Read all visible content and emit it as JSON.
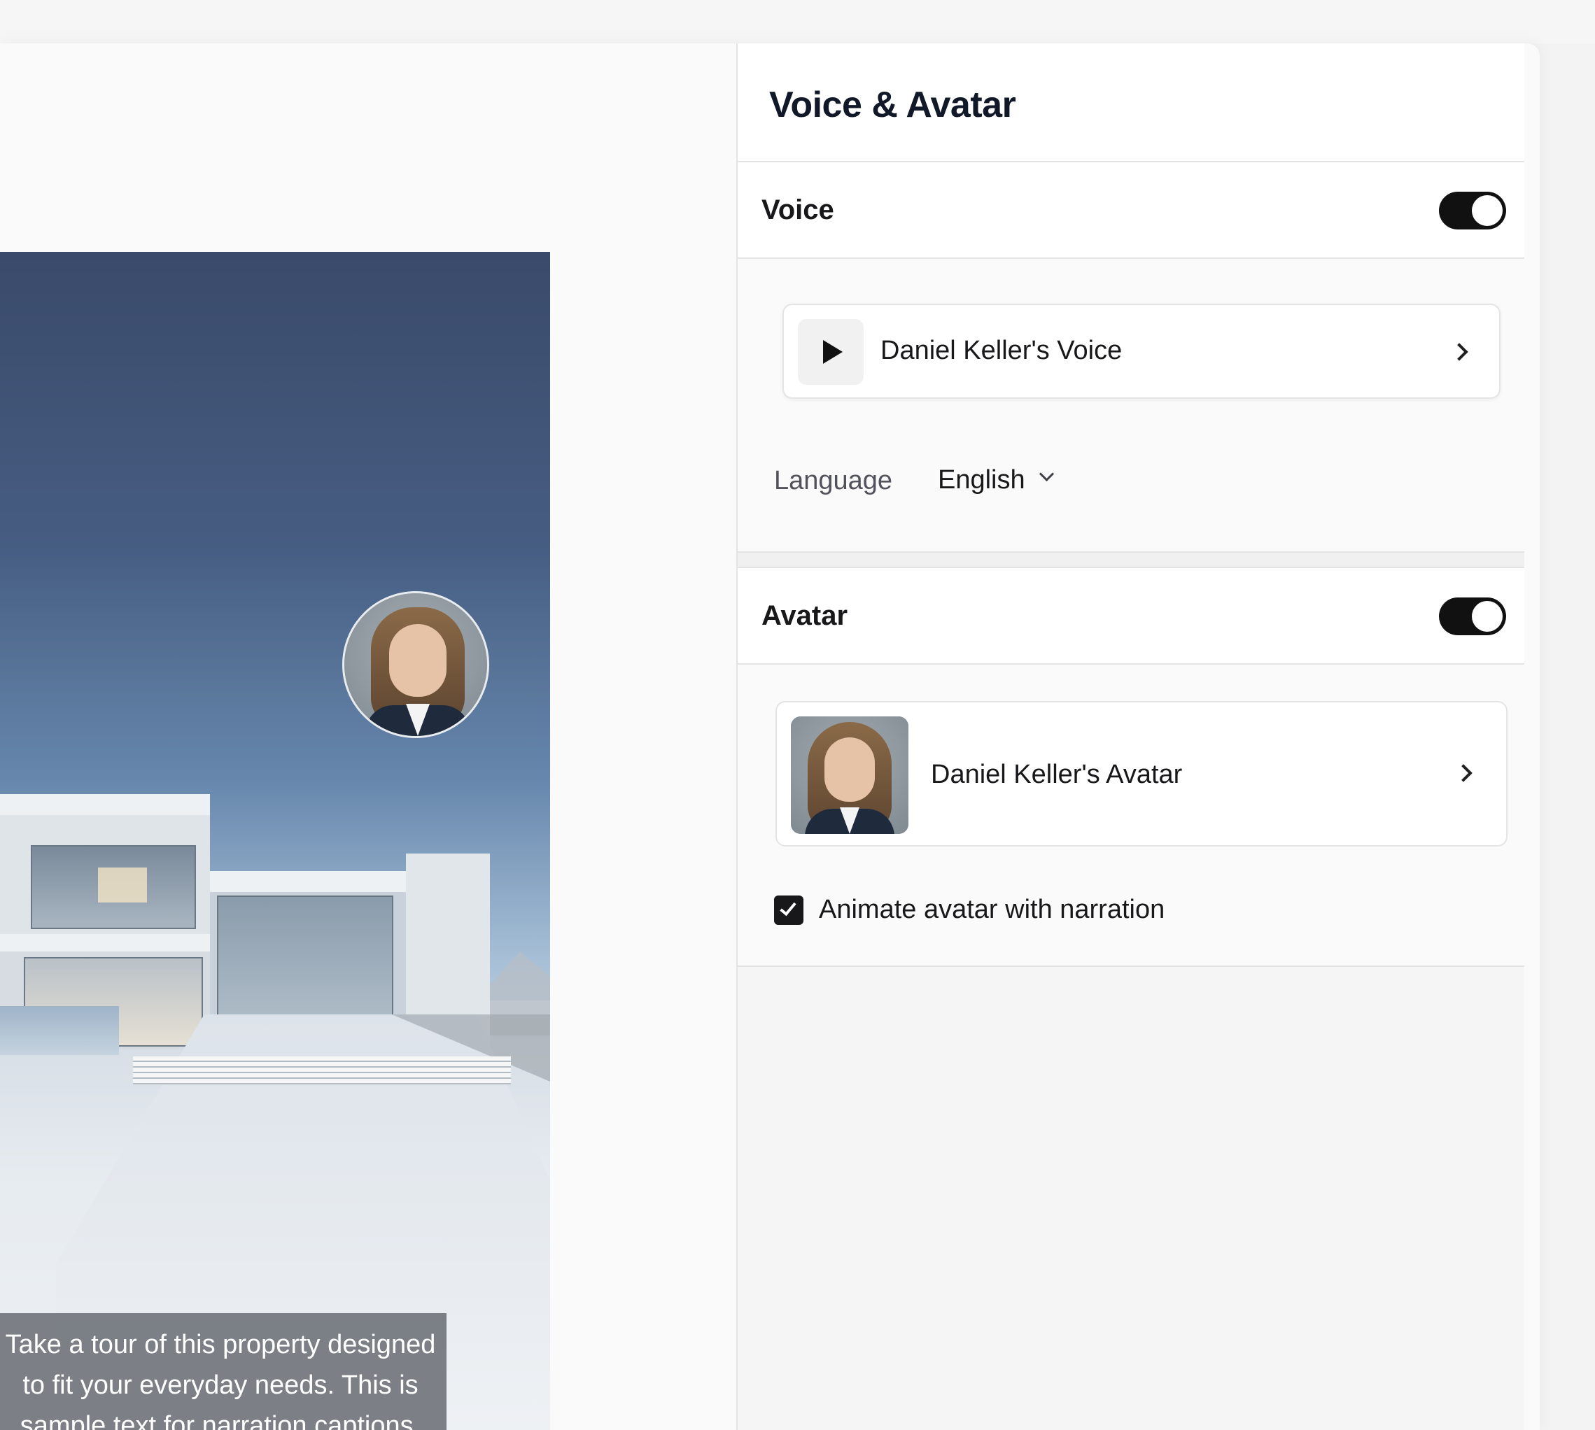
{
  "panel": {
    "title": "Voice & Avatar"
  },
  "voice_section": {
    "title": "Voice",
    "enabled": true,
    "selected_voice": "Daniel Keller's Voice",
    "language_label": "Language",
    "language_value": "English"
  },
  "avatar_section": {
    "title": "Avatar",
    "enabled": true,
    "selected_avatar": "Daniel Keller's Avatar",
    "animate_label": "Animate avatar with narration",
    "animate_checked": true
  },
  "preview": {
    "caption_lines": [
      "Take a tour of this property designed",
      "to fit your everyday needs. This is",
      "sample text for narration captions."
    ]
  },
  "icons": {
    "play": "play-icon",
    "chevron": "chevron-right-icon",
    "dropdown": "chevron-down-icon",
    "check": "check-icon"
  },
  "colors": {
    "toggle_on": "#111111",
    "panel_bg": "#f5f5f5",
    "caption_bg": "#50545c"
  }
}
